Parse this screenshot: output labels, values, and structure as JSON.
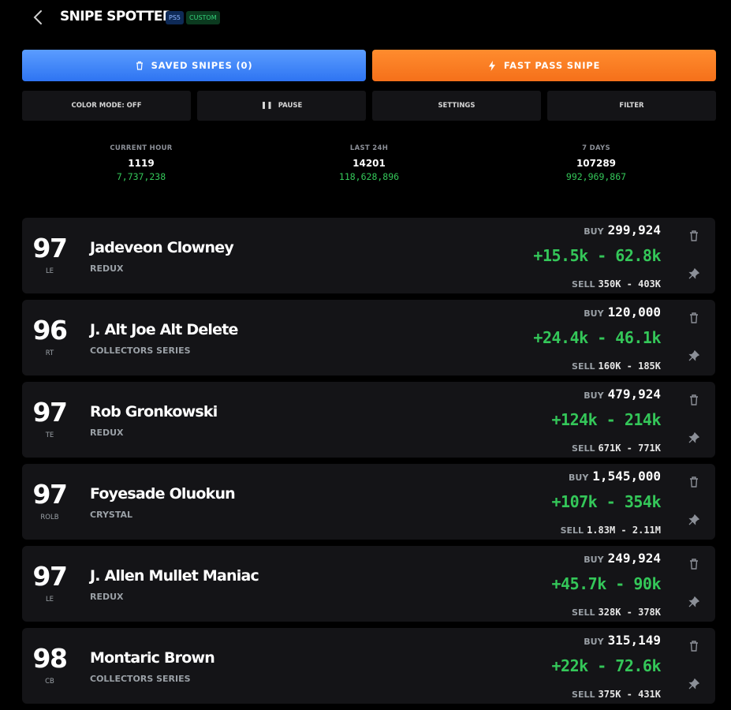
{
  "header": {
    "title": "SNIPE SPOTTER",
    "platform_badge": "PS5",
    "mode_badge": "CUSTOM",
    "back_icon": "chevron-left-icon"
  },
  "actions": {
    "saved_label": "SAVED SNIPES (0)",
    "fast_label": "FAST PASS SNIPE",
    "saved_color": "#3b82f6",
    "fast_color": "#f97316"
  },
  "controls": {
    "color_mode": "COLOR MODE: OFF",
    "pause": "PAUSE",
    "settings": "SETTINGS",
    "filter": "FILTER"
  },
  "stats": [
    {
      "label": "CURRENT HOUR",
      "count": "1119",
      "coins": "7,737,238"
    },
    {
      "label": "LAST 24H",
      "count": "14201",
      "coins": "118,628,896"
    },
    {
      "label": "7 DAYS",
      "count": "107289",
      "coins": "992,969,867"
    }
  ],
  "cards": [
    {
      "ovr": "97",
      "pos": "LE",
      "name": "Jadeveon Clowney",
      "program": "REDUX",
      "buy_label": "BUY",
      "buy": "299,924",
      "profit": "+15.5k - 62.8k",
      "sell_label": "SELL",
      "sell": "350K - 403K"
    },
    {
      "ovr": "96",
      "pos": "RT",
      "name": "J. Alt Joe Alt Delete",
      "program": "COLLECTORS SERIES",
      "buy_label": "BUY",
      "buy": "120,000",
      "profit": "+24.4k - 46.1k",
      "sell_label": "SELL",
      "sell": "160K - 185K"
    },
    {
      "ovr": "97",
      "pos": "TE",
      "name": "Rob Gronkowski",
      "program": "REDUX",
      "buy_label": "BUY",
      "buy": "479,924",
      "profit": "+124k - 214k",
      "sell_label": "SELL",
      "sell": "671K - 771K"
    },
    {
      "ovr": "97",
      "pos": "ROLB",
      "name": "Foyesade Oluokun",
      "program": "CRYSTAL",
      "buy_label": "BUY",
      "buy": "1,545,000",
      "profit": "+107k - 354k",
      "sell_label": "SELL",
      "sell": "1.83M - 2.11M"
    },
    {
      "ovr": "97",
      "pos": "LE",
      "name": "J. Allen Mullet Maniac",
      "program": "REDUX",
      "buy_label": "BUY",
      "buy": "249,924",
      "profit": "+45.7k - 90k",
      "sell_label": "SELL",
      "sell": "328K - 378K"
    },
    {
      "ovr": "98",
      "pos": "CB",
      "name": "Montaric Brown",
      "program": "COLLECTORS SERIES",
      "buy_label": "BUY",
      "buy": "315,149",
      "profit": "+22k - 72.6k",
      "sell_label": "SELL",
      "sell": "375K - 431K"
    }
  ],
  "colors": {
    "background": "#000000",
    "card": "#141417",
    "profit_green": "#34c759",
    "muted": "#9aa0a6"
  }
}
